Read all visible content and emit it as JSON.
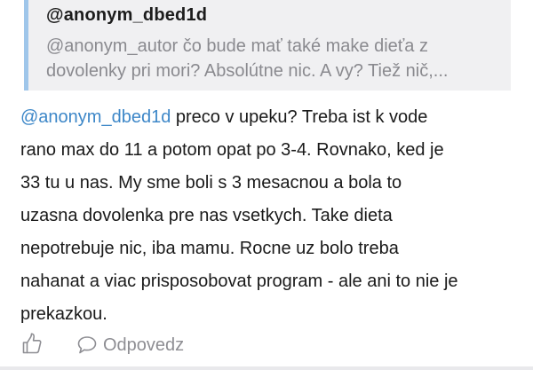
{
  "quote": {
    "author": "@anonym_dbed1d",
    "lines": [
      "@anonym_autor čo bude mať také make dieťa z",
      "dovolenky pri mori? Absolútne nic. A vy? Tiež nič,..."
    ]
  },
  "comment": {
    "mention": "@anonym_dbed1d",
    "first_line_rest": " preco v upeku? Treba ist k vode",
    "lines": [
      "rano max do 11 a potom opat po 3-4. Rovnako, ked je",
      "33 tu u nas. My sme boli s 3 mesacnou a bola to",
      "uzasna dovolenka pre nas vsetkych. Take dieta",
      "nepotrebuje nic, iba mamu. Rocne uz bolo treba",
      "nahanat a viac prisposobovat program - ale ani to nie je",
      "prekazkou."
    ]
  },
  "actions": {
    "like_icon": "thumbs-up-icon",
    "reply_icon": "speech-bubble-icon",
    "reply_label": "Odpovedz"
  },
  "colors": {
    "mention": "#3d87c8",
    "quote_bar": "#9fc6ea",
    "quote_bg": "#f0f0f2",
    "muted": "#8e8e93"
  }
}
